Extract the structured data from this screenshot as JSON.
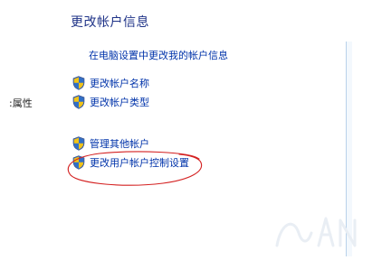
{
  "panel": {
    "title": "更改帐户信息",
    "pc_settings_link": "在电脑设置中更改我的帐户信息",
    "change_name": "更改帐户名称",
    "change_type": "更改帐户类型",
    "manage_accounts": "管理其他帐户",
    "uac_settings": "更改用户帐户控制设置"
  },
  "left_pane": {
    "properties_label": ":属性"
  },
  "colors": {
    "title": "#1e3287",
    "link": "#0033aa",
    "annotation_circle": "#d42020"
  },
  "icons": {
    "task_icon": "uac-shield-icon"
  }
}
